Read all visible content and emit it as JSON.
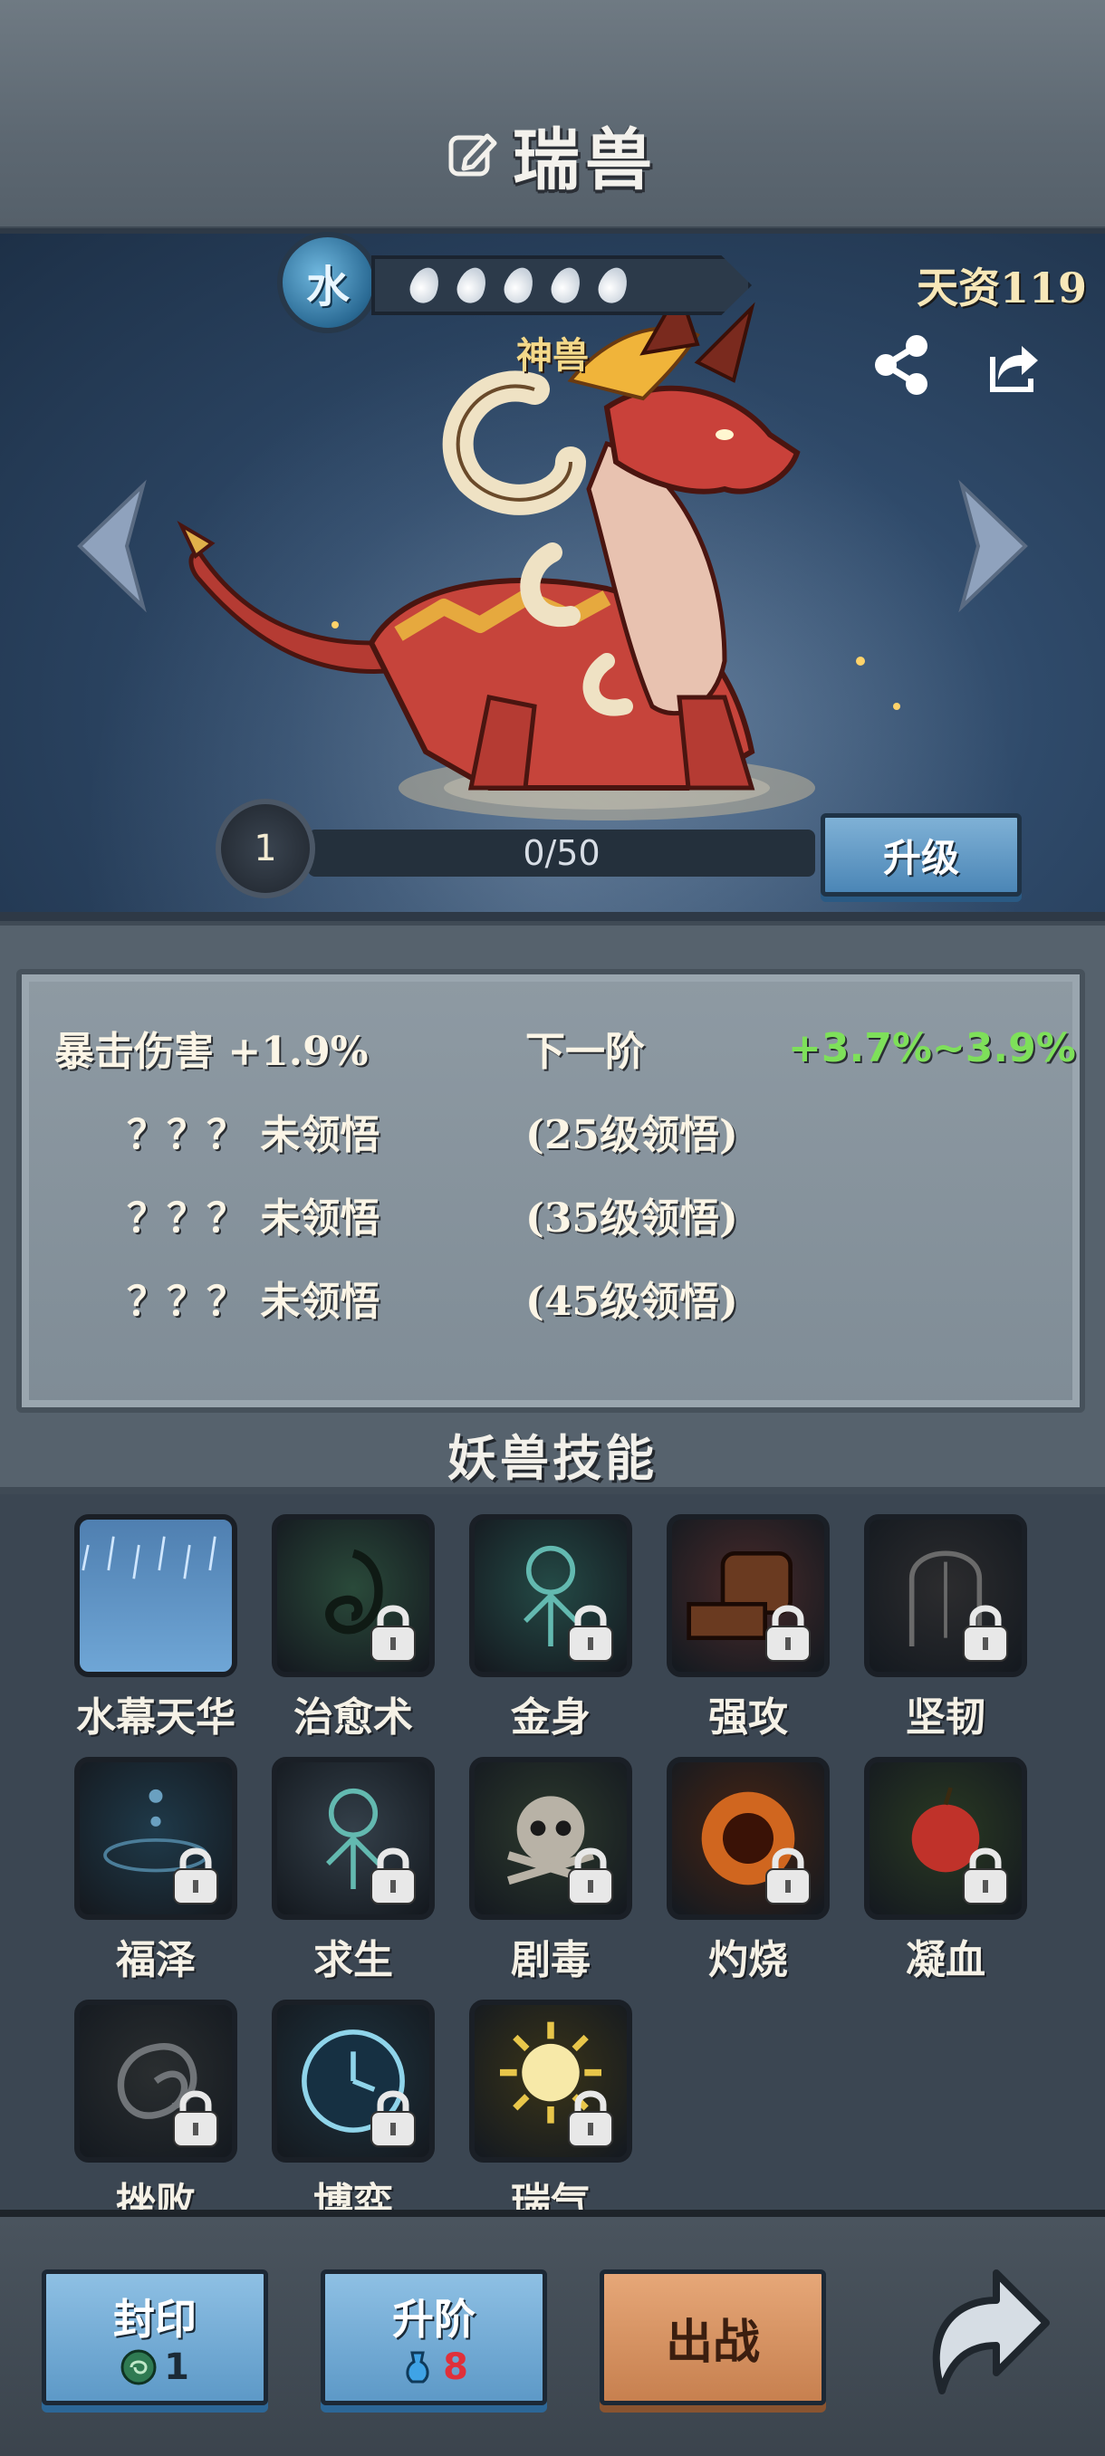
{
  "header": {
    "title": "瑞兽"
  },
  "beast": {
    "element": "水",
    "talent": "天资119",
    "name": "神兽",
    "level": "1",
    "exp": "0/50",
    "upgrade_label": "升级"
  },
  "attributes": {
    "main": {
      "name": "暴击伤害 +1.9%",
      "next_label": "下一阶",
      "next_value": "+3.7%~3.9%"
    },
    "locked": [
      {
        "name": "？？？ 未领悟",
        "hint": "(25级领悟)"
      },
      {
        "name": "？？？ 未领悟",
        "hint": "(35级领悟)"
      },
      {
        "name": "？？？ 未领悟",
        "hint": "(45级领悟)"
      }
    ]
  },
  "skills": {
    "title": "妖兽技能",
    "items": [
      {
        "label": "水幕天华",
        "icon": "rain-icon",
        "locked": false,
        "color": "#6fa6d6"
      },
      {
        "label": "治愈术",
        "icon": "spiral-icon",
        "locked": true,
        "color": "#2a4a3a"
      },
      {
        "label": "金身",
        "icon": "figure-icon",
        "locked": true,
        "color": "#244a46"
      },
      {
        "label": "强攻",
        "icon": "fist-icon",
        "locked": true,
        "color": "#4a2a2a"
      },
      {
        "label": "坚韧",
        "icon": "helmet-icon",
        "locked": true,
        "color": "#2c2c2e"
      },
      {
        "label": "福泽",
        "icon": "ripple-icon",
        "locked": true,
        "color": "#1f3a4a"
      },
      {
        "label": "求生",
        "icon": "figure-icon",
        "locked": true,
        "color": "#34404a"
      },
      {
        "label": "剧毒",
        "icon": "skull-icon",
        "locked": true,
        "color": "#2d3a2d"
      },
      {
        "label": "灼烧",
        "icon": "fire-icon",
        "locked": true,
        "color": "#4a2412"
      },
      {
        "label": "凝血",
        "icon": "apple-icon",
        "locked": true,
        "color": "#2a3a22"
      },
      {
        "label": "挫败",
        "icon": "vortex-icon",
        "locked": true,
        "color": "#2a2e30"
      },
      {
        "label": "博弈",
        "icon": "clock-icon",
        "locked": true,
        "color": "#1e3440"
      },
      {
        "label": "瑞气",
        "icon": "sun-icon",
        "locked": true,
        "color": "#3a3418"
      }
    ]
  },
  "bottom": {
    "seal": {
      "label": "封印",
      "count": "1"
    },
    "advance": {
      "label": "升阶",
      "count": "8"
    },
    "battle": {
      "label": "出战"
    }
  },
  "colors": {
    "accent_green": "#7ee05a",
    "gold": "#f4d98a",
    "count_red": "#e0303a"
  }
}
